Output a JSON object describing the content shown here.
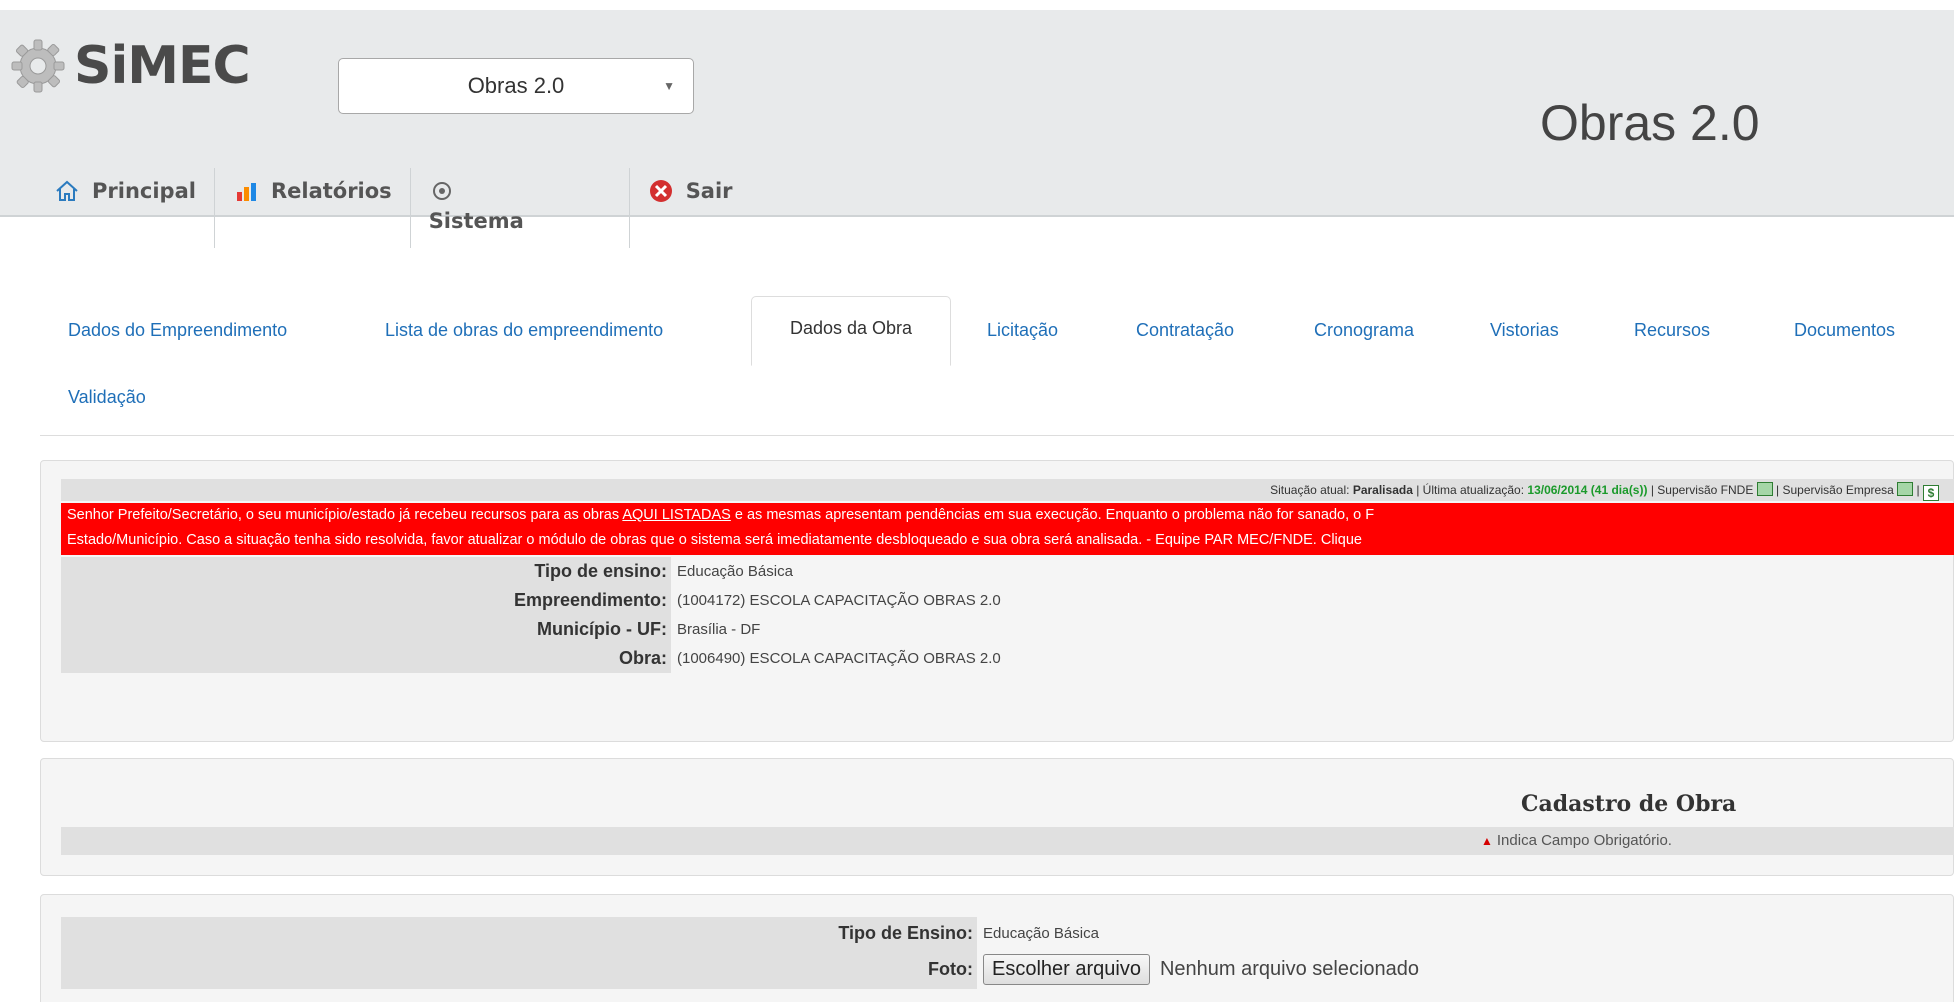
{
  "header": {
    "logo_text": "SiMEC",
    "module_select_value": "Obras 2.0",
    "app_title": "Obras 2.0"
  },
  "menu": {
    "principal": "Principal",
    "relatorios": "Relatórios",
    "sistema": "Sistema",
    "sair": "Sair"
  },
  "tabs": [
    "Dados do Empreendimento",
    "Lista de obras do empreendimento",
    "Dados da Obra",
    "Licitação",
    "Contratação",
    "Cronograma",
    "Vistorias",
    "Recursos",
    "Documentos",
    "Validação"
  ],
  "status": {
    "prefix": "Situação atual:",
    "situacao": "Paralisada",
    "update_label": "Última atualização:",
    "update_value": "13/06/2014 (41 dia(s))",
    "supervisao_fnde": "Supervisão FNDE",
    "supervisao_empresa": "Supervisão Empresa"
  },
  "alert": {
    "line1_a": "Senhor Prefeito/Secretário, o seu município/estado já recebeu recursos para as obras ",
    "line1_link": "AQUI LISTADAS",
    "line1_b": " e as mesmas apresentam pendências em sua execução. Enquanto o problema não for sanado, o F",
    "line2": "Estado/Município. Caso a situação tenha sido resolvida, favor atualizar o módulo de obras que o sistema será imediatamente desbloqueado e sua obra será analisada. - Equipe PAR MEC/FNDE. Clique"
  },
  "info": {
    "tipo_ensino_label": "Tipo de ensino:",
    "tipo_ensino_value": "Educação Básica",
    "empreendimento_label": "Empreendimento:",
    "empreendimento_value": "(1004172) ESCOLA CAPACITAÇÃO OBRAS 2.0",
    "municipio_label": "Município - UF:",
    "municipio_value": "Brasília - DF",
    "obra_label": "Obra:",
    "obra_value": "(1006490) ESCOLA CAPACITAÇÃO OBRAS 2.0"
  },
  "cadastro": {
    "title": "Cadastro de Obra",
    "required_note": "Indica Campo Obrigatório."
  },
  "form": {
    "tipo_ensino_label": "Tipo de Ensino:",
    "tipo_ensino_value": "Educação Básica",
    "foto_label": "Foto:",
    "file_button": "Escolher arquivo",
    "file_status": "Nenhum arquivo selecionado"
  },
  "colors": {
    "alert_bg": "#ff0000",
    "link": "#1f6fb8",
    "status_green": "#1b9a2b"
  }
}
